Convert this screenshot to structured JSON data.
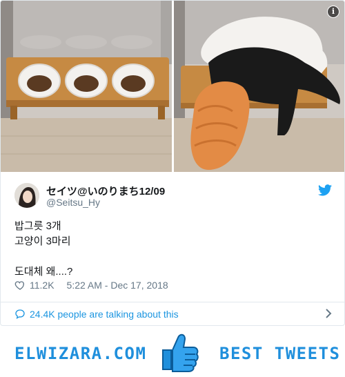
{
  "tweet": {
    "display_name": "セイツ@いのりまち12/09",
    "handle": "@Seitsu_Hy",
    "text": "밥그릇 3개\n고양이 3마리\n\n도대체 왜....?",
    "likes": "11.2K",
    "timestamp": "5:22 AM - Dec 17, 2018",
    "talking": "24.4K people are talking about this"
  },
  "icons": {
    "info": "i",
    "info_name": "info-icon",
    "bird": "twitter-bird-icon",
    "heart": "heart-icon",
    "bubble": "speech-bubble-icon",
    "chevron": "chevron-right-icon",
    "thumb": "thumbs-up-icon"
  },
  "footer": {
    "left": "ELWIZARA.COM",
    "right": "BEST TWEETS"
  },
  "colors": {
    "accent": "#1b95e0",
    "brand": "#1f8fdc",
    "text": "#14171a",
    "muted": "#657786",
    "border": "#e1e8ed"
  }
}
